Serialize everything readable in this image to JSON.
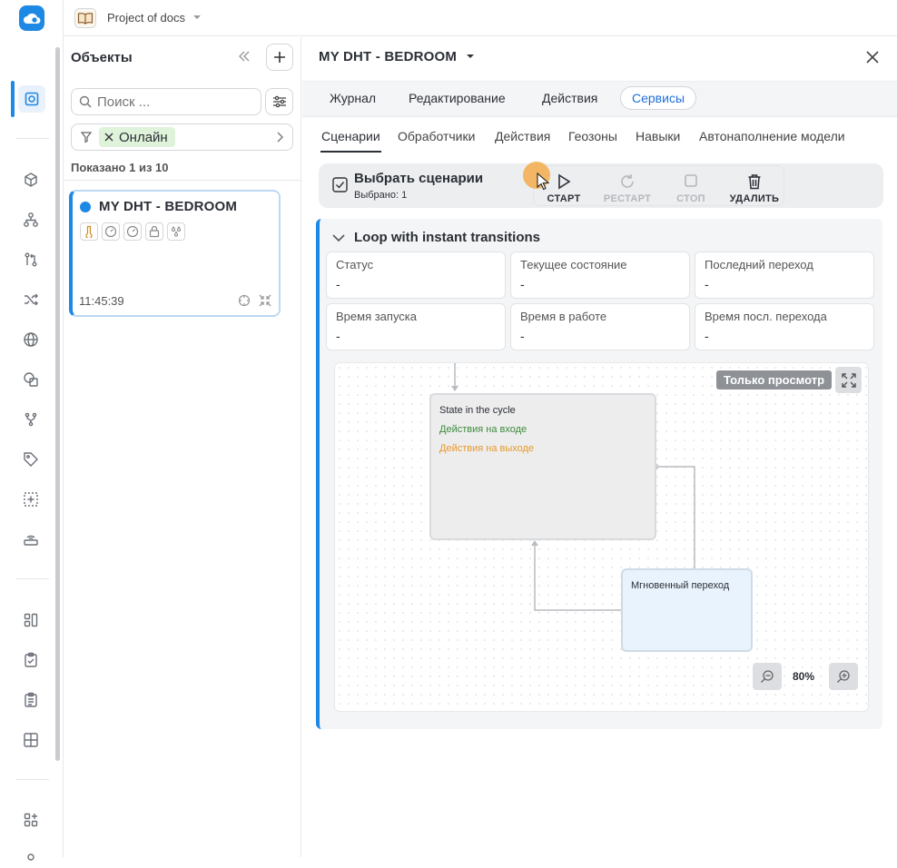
{
  "topbar": {
    "project_name": "Project of docs"
  },
  "rail": {
    "items": [
      "objects-icon",
      "cube-icon",
      "hierarchy-icon",
      "git-compare-icon",
      "shuffle-icon",
      "globe-icon",
      "shapes-icon",
      "fork-icon",
      "tag-icon",
      "add-frame-icon",
      "router-icon",
      "dashboard-icon",
      "clipboard-check-icon",
      "clipboard-list-icon",
      "grid-icon",
      "apps-add-icon"
    ]
  },
  "objects": {
    "title": "Объекты",
    "search_placeholder": "Поиск ...",
    "filter_chip": "Онлайн",
    "shown": "Показано 1 из 10",
    "card": {
      "name": "MY DHT - BEDROOM",
      "time": "11:45:39",
      "status_color": "#1e88e5"
    }
  },
  "main": {
    "title": "MY DHT - BEDROOM",
    "tabs": [
      "Журнал",
      "Редактирование",
      "Действия",
      "Сервисы"
    ],
    "active_tab": "Сервисы",
    "subtabs": [
      "Сценарии",
      "Обработчики",
      "Действия",
      "Геозоны",
      "Навыки",
      "Автонаполнение модели"
    ],
    "active_subtab": "Сценарии",
    "toolbar": {
      "select_title": "Выбрать сценарии",
      "selected": "Выбрано: 1",
      "start": "СТАРТ",
      "restart": "РЕСТАРТ",
      "stop": "СТОП",
      "delete": "УДАЛИТЬ"
    },
    "scenario": {
      "title": "Loop with instant transitions",
      "stats": [
        {
          "key": "Статус",
          "value": "-"
        },
        {
          "key": "Текущее состояние",
          "value": "-"
        },
        {
          "key": "Последний переход",
          "value": "-"
        },
        {
          "key": "Время запуска",
          "value": "-"
        },
        {
          "key": "Время в работе",
          "value": "-"
        },
        {
          "key": "Время посл. перехода",
          "value": "-"
        }
      ],
      "canvas": {
        "readonly_label": "Только просмотр",
        "state_title": "State in the cycle",
        "entry_actions": "Действия на входе",
        "exit_actions": "Действия на выходе",
        "transition_title": "Мгновенный переход",
        "zoom": "80%"
      }
    }
  },
  "colors": {
    "accent": "#1e88e5",
    "online_chip": "#dff3da",
    "entry": "#3d8b3a",
    "exit": "#e79a2b"
  }
}
